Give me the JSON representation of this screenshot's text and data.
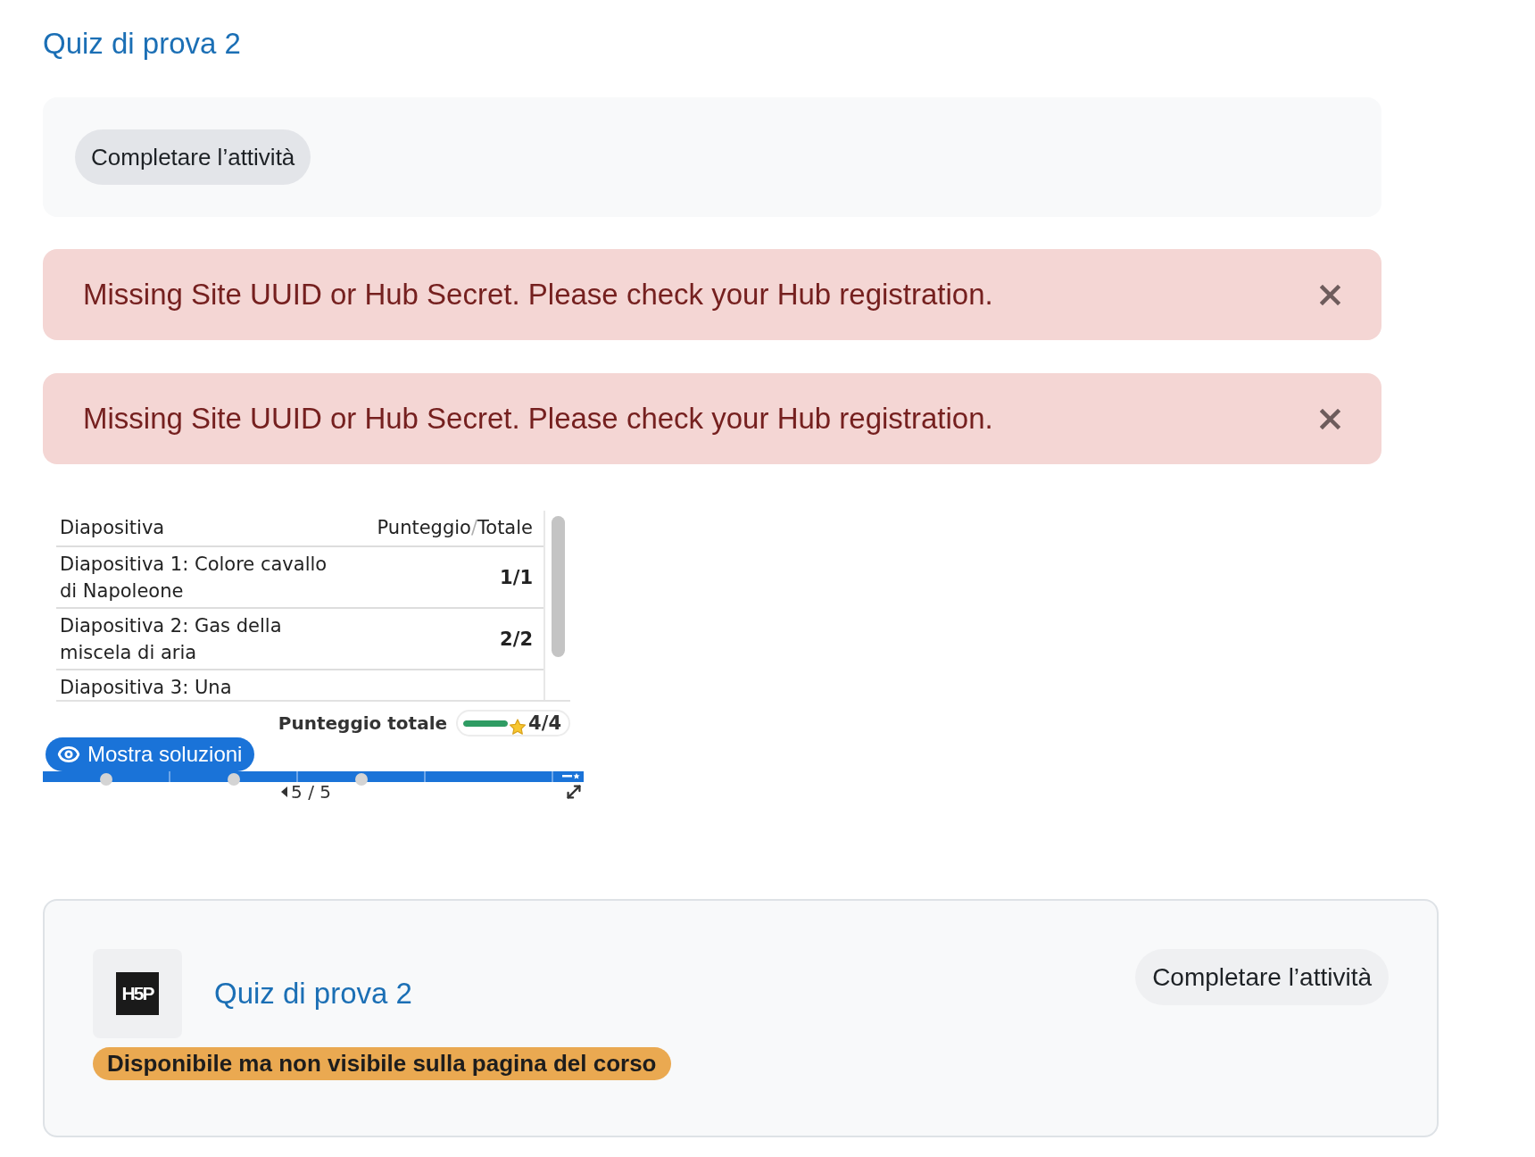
{
  "page_title": "Quiz di prova 2",
  "completion_panel": {
    "button": "Completare l’attività"
  },
  "alerts": [
    {
      "message": "Missing Site UUID or Hub Secret. Please check your Hub registration."
    },
    {
      "message": "Missing Site UUID or Hub Secret. Please check your Hub registration."
    }
  ],
  "h5p": {
    "summary_table": {
      "columns": {
        "slide": "Diapositiva",
        "score": "Punteggio",
        "separator": "/",
        "total": "Totale"
      },
      "rows": [
        {
          "slide": "Diapositiva 1: Colore cavallo di Napoleone",
          "score": "1/1"
        },
        {
          "slide": "Diapositiva 2: Gas della miscela di aria",
          "score": "2/2"
        },
        {
          "slide": "Diapositiva 3: Una"
        }
      ]
    },
    "total": {
      "label": "Punteggio totale",
      "level": 1,
      "score": "4/4"
    },
    "solutions_button": "Mostra soluzioni",
    "navigation": {
      "level": 1,
      "segments": [
        {
          "kind": "task"
        },
        {
          "kind": "task"
        },
        {
          "kind": "task"
        },
        {
          "kind": "plain"
        },
        {
          "kind": "summary"
        }
      ],
      "counter": "5 / 5"
    }
  },
  "activity_card": {
    "logo": "H5P",
    "title": "Quiz di prova 2",
    "badge": "Disponibile ma non visibile sulla pagina del corso",
    "button": "Completare l’attività"
  }
}
